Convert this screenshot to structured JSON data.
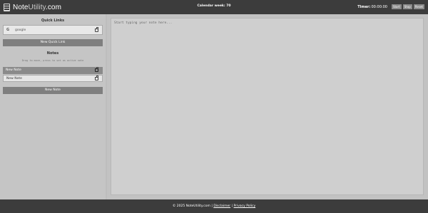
{
  "header": {
    "logo_primary": "Note",
    "logo_secondary": "Utility",
    "logo_suffix": ".com",
    "calendar_week": "Calendar week: 70",
    "timer_label": "Timer:",
    "timer_value": "00:00:00",
    "buttons": {
      "start": "Start",
      "stop": "Stop",
      "reset": "Reset"
    }
  },
  "sidebar": {
    "quick_links_title": "Quick Links",
    "quick_links": [
      {
        "label": "google",
        "icon": "google-icon"
      }
    ],
    "new_quick_link_label": "New Quick Link",
    "notes_title": "Notes",
    "notes_hint": "Drag to move, press to set as active note",
    "notes": [
      {
        "label": "New Note",
        "active": true
      },
      {
        "label": "New Note",
        "active": false
      }
    ],
    "new_note_label": "New Note"
  },
  "editor": {
    "placeholder": "Start typing your note here..."
  },
  "footer": {
    "copyright": "© 2025 NoteUtility.com |",
    "disclaimer": "Disclaimer",
    "separator": "|",
    "privacy": "Privacy Policy"
  }
}
